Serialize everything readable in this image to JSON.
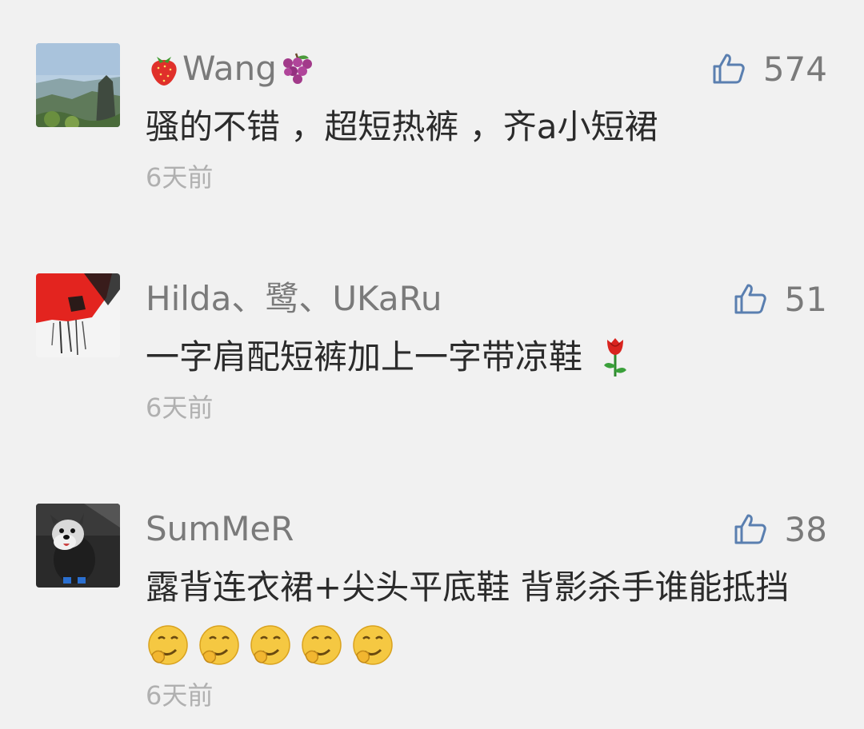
{
  "comments": [
    {
      "author": "Wang",
      "author_prefix_icon": "strawberry-emoji",
      "author_suffix_icon": "grapes-emoji",
      "avatar": "mountain-landscape-avatar",
      "likes": "574",
      "text": "骚的不错 ，超短热裤 ，齐a小短裙",
      "time": "6天前"
    },
    {
      "author": "Hilda、鹭、UKaRu",
      "avatar": "red-abstract-avatar",
      "likes": "51",
      "text": "一字肩配短裤加上一字带凉鞋",
      "text_suffix_icon": "rose-emoji",
      "time": "6天前"
    },
    {
      "author": "SumMeR",
      "avatar": "schnauzer-dog-avatar",
      "likes": "38",
      "text": "露背连衣裙+尖头平底鞋 背影杀手谁能抵挡",
      "text_suffix_icon": "grimace-emoji",
      "text_suffix_icon_count": 5,
      "time": "6天前"
    }
  ],
  "colors": {
    "background": "#f1f1f1",
    "author": "#7a7a7a",
    "text": "#2b2b2b",
    "time": "#b0b0b0",
    "like_icon": "#5a7fb0"
  }
}
